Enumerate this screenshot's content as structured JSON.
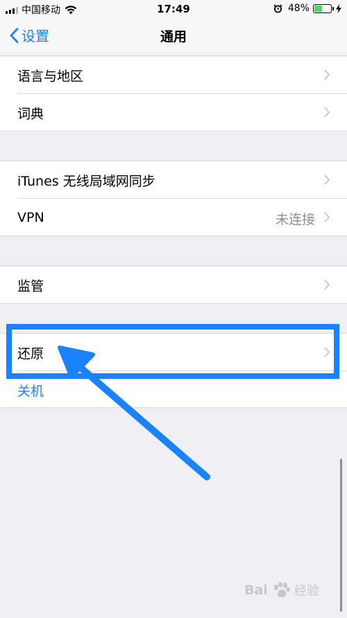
{
  "status_bar": {
    "carrier": "中国移动",
    "time": "17:49",
    "battery_percent": "48%",
    "battery_level": 0.48
  },
  "nav": {
    "back_label": "设置",
    "title": "通用"
  },
  "groups": {
    "language": [
      {
        "label": "语言与地区",
        "icon": "chevron-right-icon"
      },
      {
        "label": "词典",
        "icon": "chevron-right-icon"
      }
    ],
    "sync": [
      {
        "label": "iTunes 无线局域网同步",
        "icon": "chevron-right-icon"
      },
      {
        "label": "VPN",
        "value": "未连接",
        "icon": "chevron-right-icon"
      }
    ],
    "management": [
      {
        "label": "监管",
        "icon": "chevron-right-icon"
      }
    ],
    "reset": [
      {
        "label": "还原",
        "icon": "chevron-right-icon"
      },
      {
        "label": "关机"
      }
    ]
  },
  "watermark": {
    "brand": "Bai",
    "paw_icon": "paw-icon",
    "suffix": "经验"
  },
  "colors": {
    "accent": "#1a82fb",
    "secondary_text": "#8e8e93",
    "background": "#efeff4",
    "annotation": "#1a82fb"
  }
}
